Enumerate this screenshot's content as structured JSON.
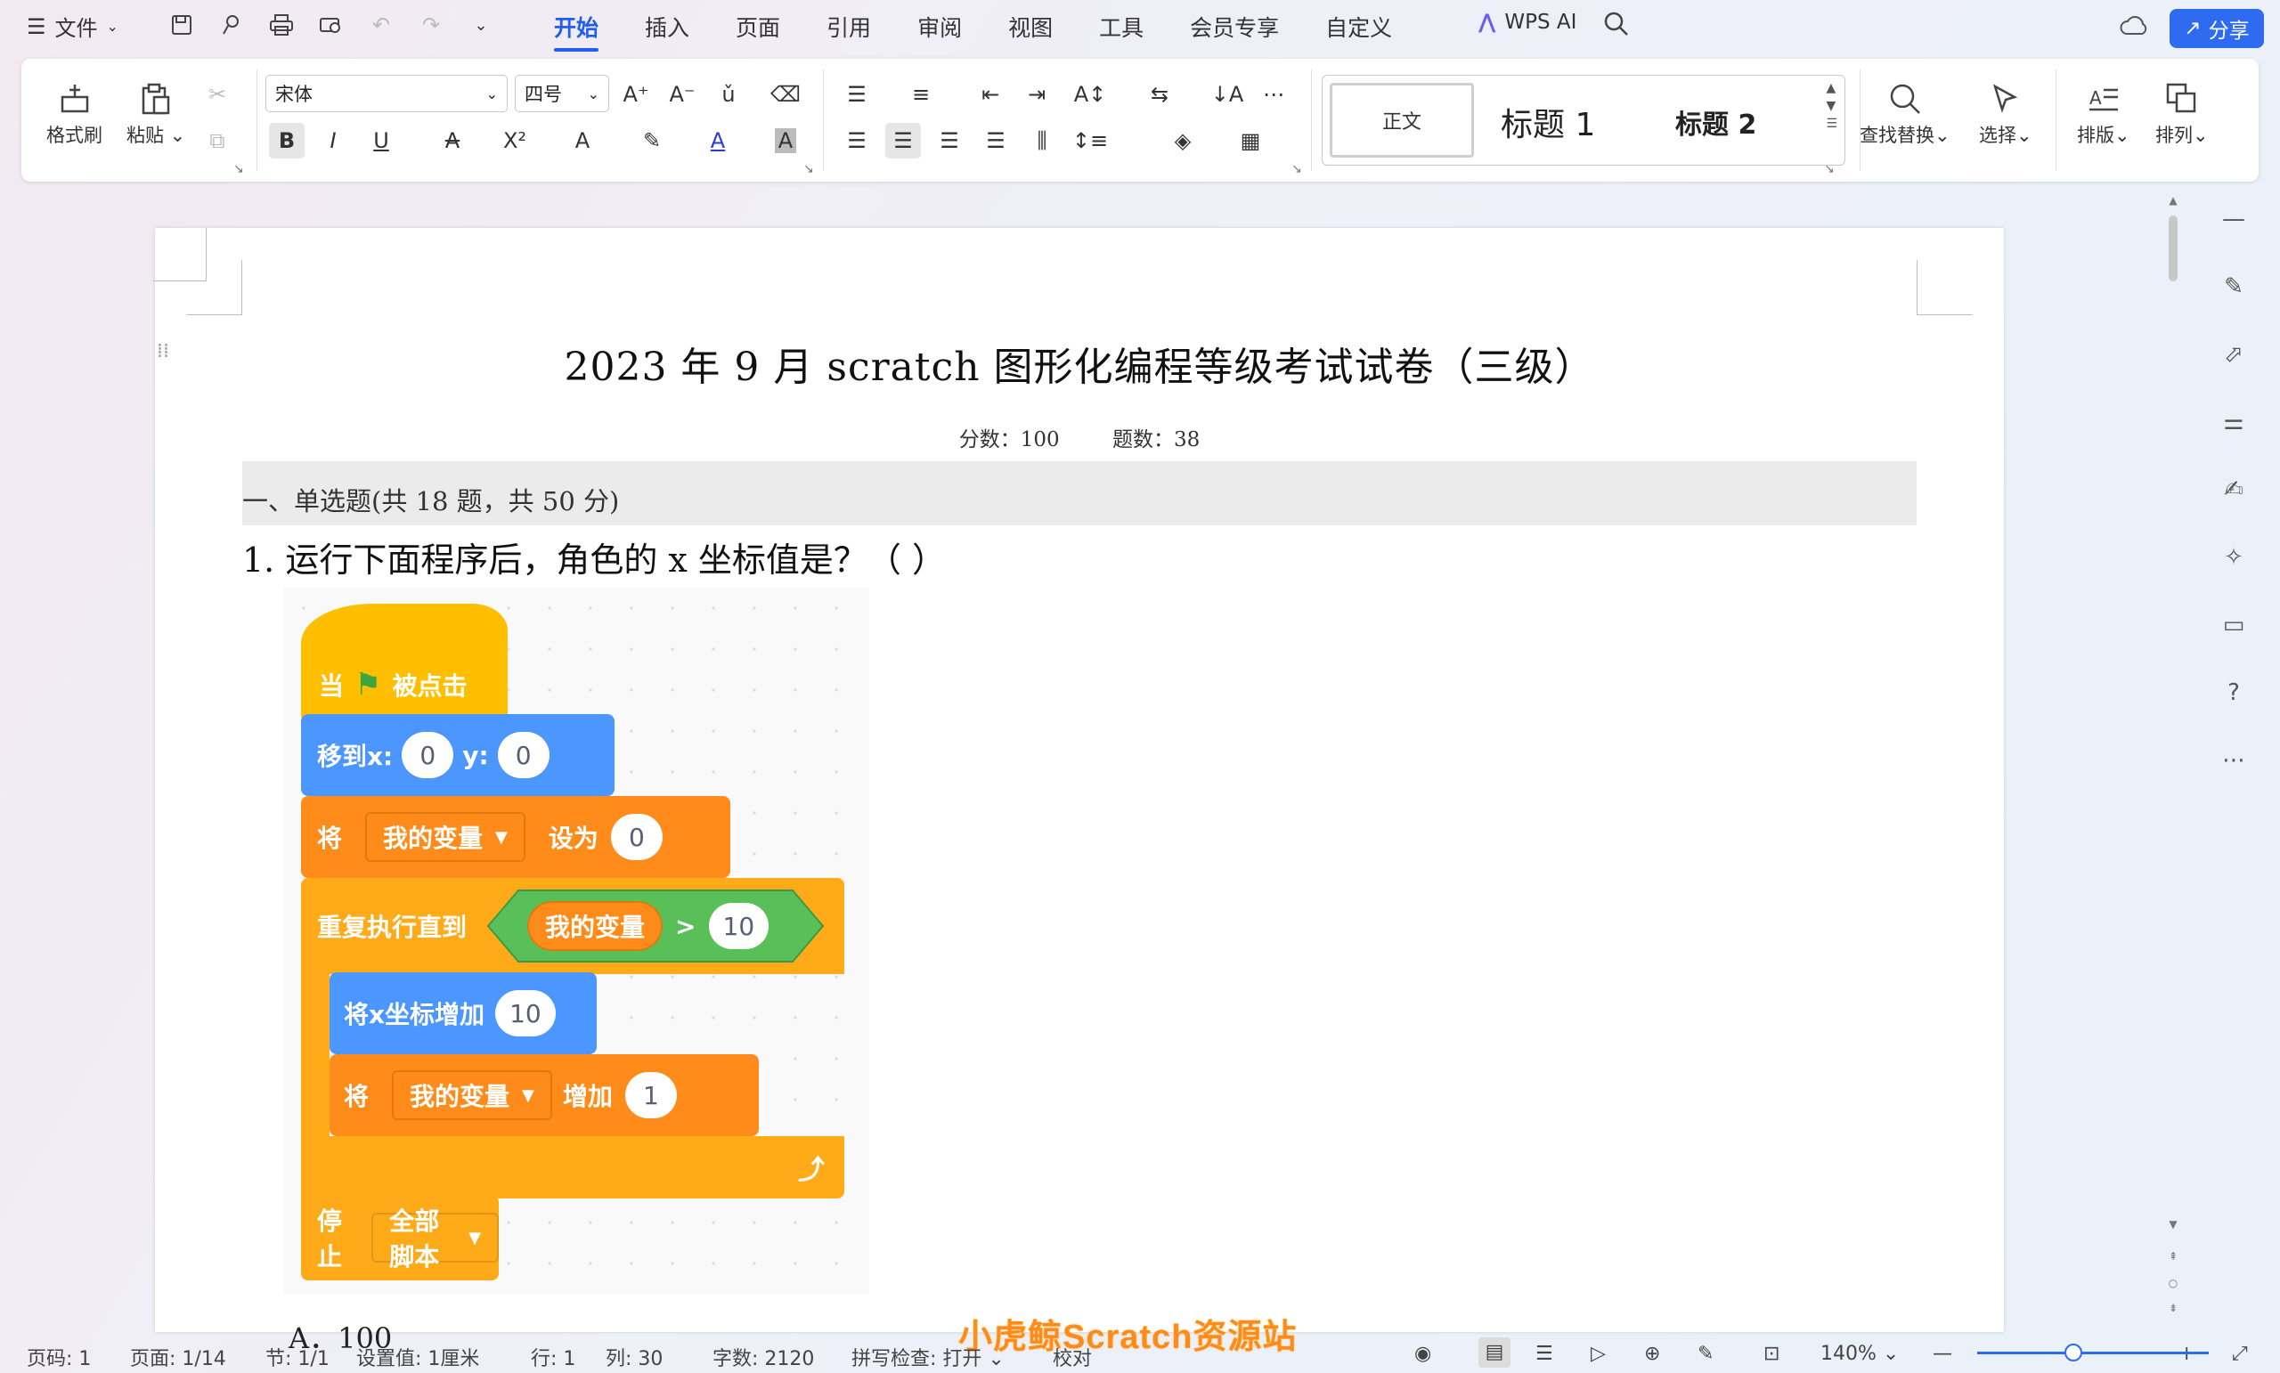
{
  "menubar": {
    "file_label": "文件",
    "tabs": [
      "开始",
      "插入",
      "页面",
      "引用",
      "审阅",
      "视图",
      "工具",
      "会员专享",
      "自定义"
    ],
    "active_tab": "开始",
    "ai_label": "WPS AI",
    "share_label": "分享"
  },
  "ribbon": {
    "format_painter": "格式刷",
    "paste": "粘贴",
    "font_name": "宋体",
    "font_size": "四号",
    "styles": {
      "normal": "正文",
      "h1": "标题 1",
      "h2": "标题 2"
    },
    "find_replace": "查找替换",
    "select": "选择",
    "layout": "排版",
    "arrange": "排列"
  },
  "document": {
    "title": "2023 年 9 月 scratch 图形化编程等级考试试卷（三级）",
    "score": "分数：100",
    "count": "题数：38",
    "section": "一、单选题(共 18 题，共 50 分)",
    "question": "1. 运行下面程序后，角色的 x 坐标值是？（    ）",
    "partial_line": "A．100",
    "scratch": {
      "when_label": "当",
      "clicked_label": "被点击",
      "goto_label": "移到x:",
      "goto_x": "0",
      "goto_y_label": "y:",
      "goto_y": "0",
      "set_label": "将",
      "set_var": "我的变量",
      "set_to": "设为",
      "set_val": "0",
      "repeat_label": "重复执行直到",
      "cond_var": "我的变量",
      "cond_op": ">",
      "cond_val": "10",
      "changex_label": "将x坐标增加",
      "changex_val": "10",
      "change_label": "将",
      "change_var": "我的变量",
      "change_op": "增加",
      "change_val": "1",
      "stop_label": "停止",
      "stop_opt": "全部脚本"
    }
  },
  "statusbar": {
    "page_code": "页码: 1",
    "pages": "页面: 1/14",
    "section": "节: 1/1",
    "setting": "设置值: 1厘米",
    "row": "行: 1",
    "col": "列: 30",
    "words": "字数: 2120",
    "spell": "拼写检查: 打开",
    "proof": "校对",
    "zoom": "140%"
  },
  "watermark": "小虎鲸Scratch资源站",
  "colors": {
    "accent": "#1f5ef0",
    "scratch_events": "#ffbf00",
    "scratch_motion": "#4c97ff",
    "scratch_variables": "#ff8c1a",
    "scratch_control": "#ffab19",
    "scratch_operators": "#59c059"
  }
}
